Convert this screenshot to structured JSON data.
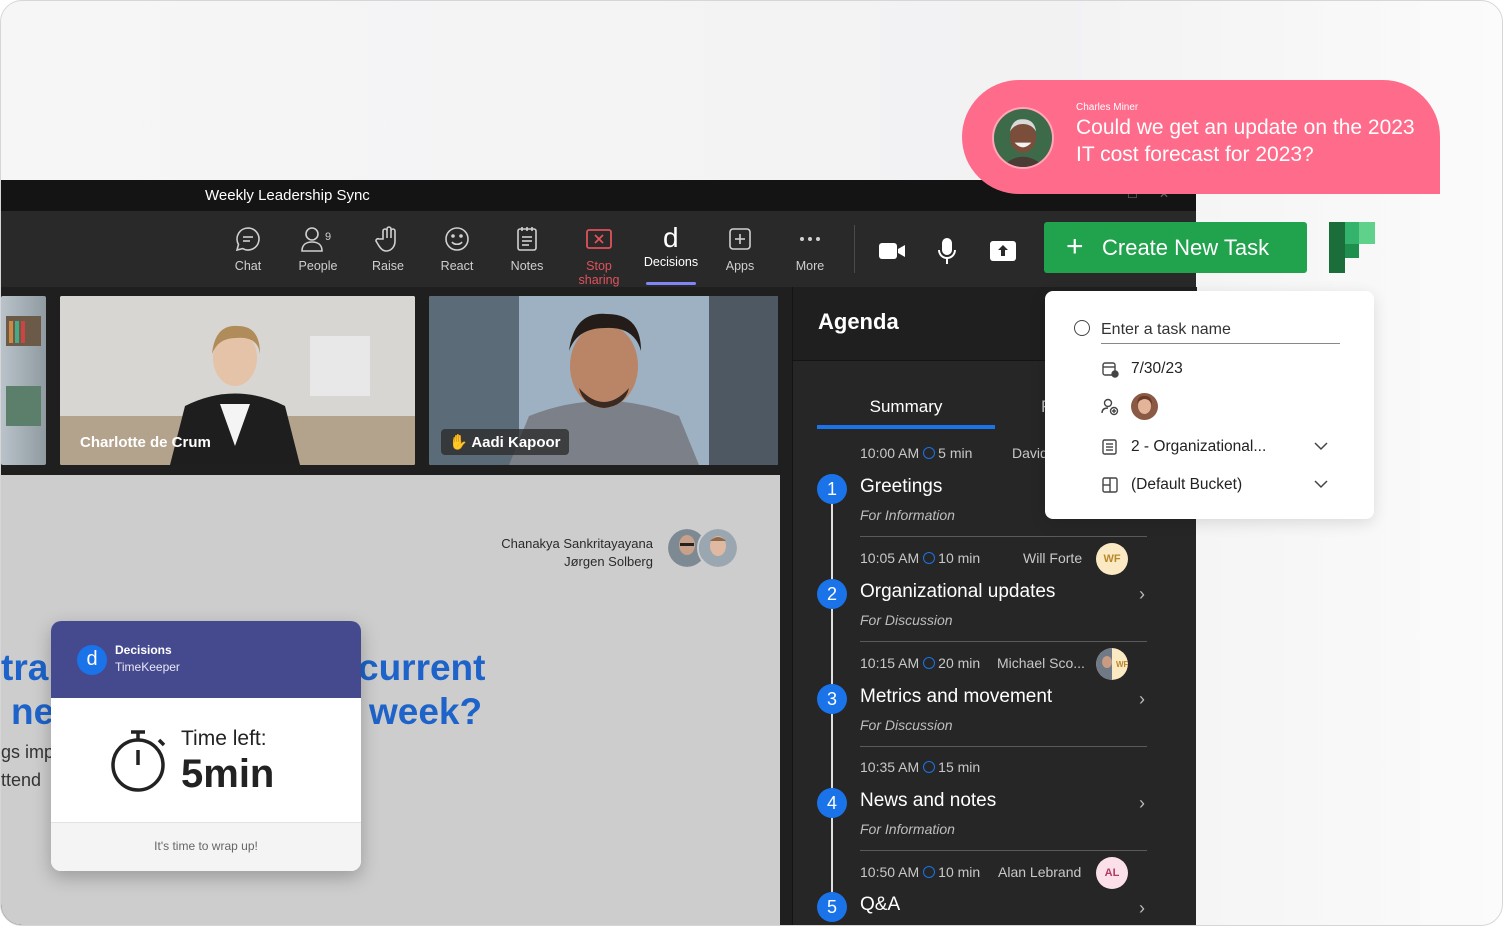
{
  "window": {
    "title": "Weekly Leadership Sync"
  },
  "toolbar": {
    "chat": "Chat",
    "people": "People",
    "people_count": "9",
    "raise": "Raise",
    "react": "React",
    "notes": "Notes",
    "stop_sharing": "Stop sharing",
    "decisions": "Decisions",
    "apps": "Apps",
    "more": "More"
  },
  "participants": [
    {
      "name": "Charlotte de Crum"
    },
    {
      "name": "Aadi Kapoor",
      "hand_raised": true
    }
  ],
  "slide": {
    "presenters": [
      "Chanakya Sankritayayana",
      "Jørgen Solberg"
    ],
    "q_line1_left": "tra",
    "q_line1_right": "current",
    "q_line2_left": "ne",
    "q_line2_right": "week?",
    "small_line1": "gs imp",
    "small_line2": "ttend"
  },
  "timekeeper": {
    "app": "Decisions",
    "sub": "TimeKeeper",
    "label": "Time left:",
    "value": "5min",
    "footer": "It's time to wrap up!"
  },
  "agenda": {
    "title": "Agenda",
    "tab_active": "Summary",
    "tab_other": "F",
    "items": [
      {
        "num": "1",
        "time": "10:00 AM",
        "duration": "5 min",
        "owner": "David",
        "title": "Greetings",
        "type": "For Information"
      },
      {
        "num": "2",
        "time": "10:05 AM",
        "duration": "10 min",
        "owner": "Will Forte",
        "owner_initials": "WF",
        "title": "Organizational updates",
        "type": "For Discussion"
      },
      {
        "num": "3",
        "time": "10:15 AM",
        "duration": "20 min",
        "owner": "Michael Sco...",
        "owner_initials": "WF",
        "title": "Metrics and movement",
        "type": "For Discussion"
      },
      {
        "num": "4",
        "time": "10:35 AM",
        "duration": "15 min",
        "owner": "",
        "title": "News and notes",
        "type": "For Information"
      },
      {
        "num": "5",
        "time": "10:50 AM",
        "duration": "10 min",
        "owner": "Alan Lebrand",
        "owner_initials": "AL",
        "title": "Q&A",
        "type": ""
      }
    ]
  },
  "task": {
    "create_label": "Create New Task",
    "name_placeholder": "Enter a task name",
    "due_date": "7/30/23",
    "plan": "2 - Organizational...",
    "bucket": "(Default Bucket)"
  },
  "toast": {
    "sender": "Charles Miner",
    "message": "Could we get an update on the 2023 IT cost forecast for 2023?"
  },
  "colors": {
    "teams_bg": "#1f1f1f",
    "accent_blue": "#1a73e8",
    "planner_green": "#21a24d",
    "toast_pink": "#ff6b8b",
    "timekeeper_header": "#454a8f",
    "stop_red": "#e0525a"
  }
}
